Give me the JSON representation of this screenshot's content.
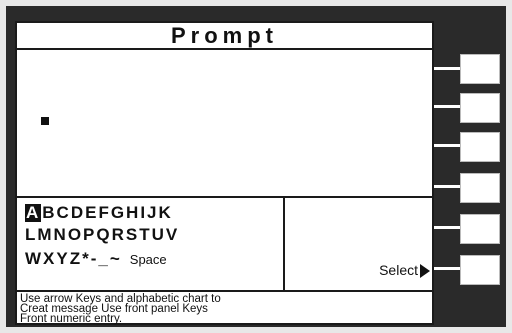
{
  "screen": {
    "title": "Prompt",
    "character_chart": {
      "selected": "A",
      "rows": [
        "BCDEFGHIJK",
        "LMNOPQRSTUV",
        "WXYZ*-_~"
      ],
      "space_label": "Space"
    },
    "select_label": "Select",
    "help_lines": [
      "Use arrow Keys and alphabetic chart to",
      "Creat message Use front panel Keys",
      "Front numeric entry."
    ]
  },
  "softkeys": [
    {
      "name": "softkey-1",
      "label": ""
    },
    {
      "name": "softkey-2",
      "label": ""
    },
    {
      "name": "softkey-3",
      "label": ""
    },
    {
      "name": "softkey-4",
      "label": ""
    },
    {
      "name": "softkey-5",
      "label": ""
    },
    {
      "name": "softkey-6",
      "label": ""
    }
  ],
  "colors": {
    "bezel": "#2a2a2a",
    "screen": "#ffffff",
    "text": "#111111"
  }
}
